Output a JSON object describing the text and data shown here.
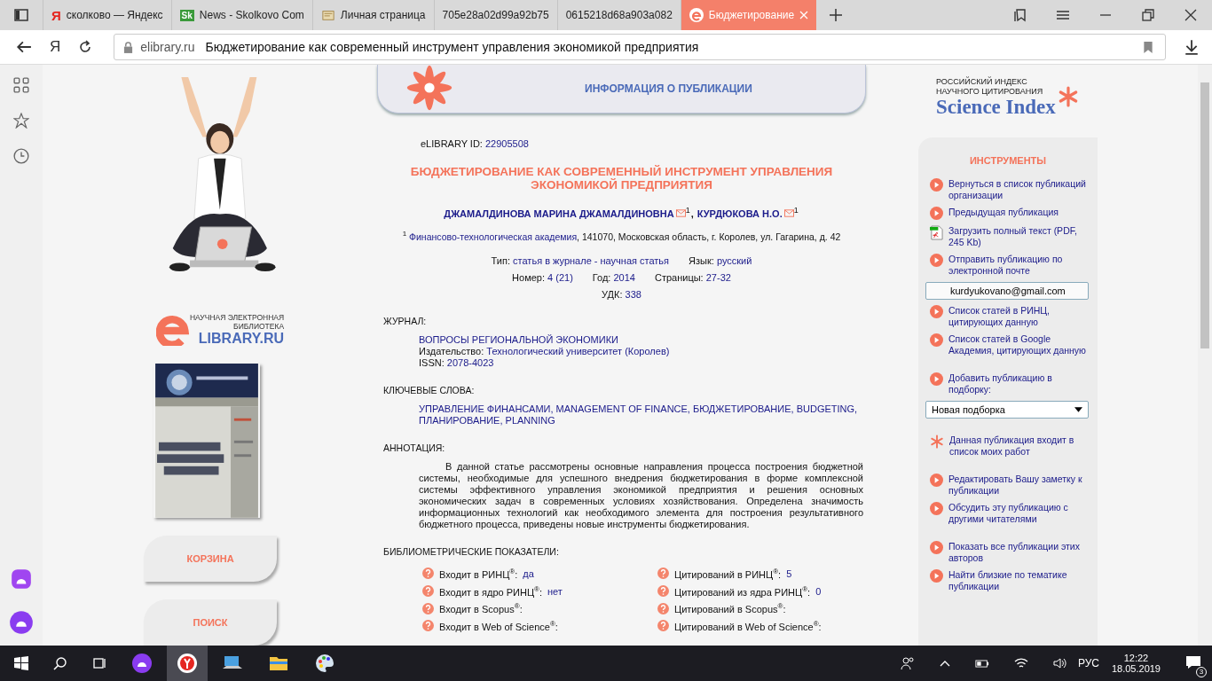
{
  "browser": {
    "tabs": [
      {
        "title": "сколково — Яндекс",
        "kind": "glyph",
        "glyph": "Я",
        "selected": false
      },
      {
        "title": "News - Skolkovo Com",
        "kind": "badge",
        "glyph": "Sk",
        "selected": false
      },
      {
        "title": "Личная страница",
        "kind": "page",
        "selected": false
      },
      {
        "title": "705e28a02d99a92b75",
        "kind": "plain",
        "selected": false
      },
      {
        "title": "0615218d68a903a082",
        "kind": "plain",
        "selected": false
      },
      {
        "title": "Бюджетирование",
        "kind": "site",
        "selected": true
      }
    ],
    "home_button": "Я",
    "address": {
      "domain": "elibrary.ru",
      "title": "Бюджетирование как современный инструмент управления экономикой предприятия"
    }
  },
  "left": {
    "logo": {
      "line1": "НАУЧНАЯ ЭЛЕКТРОННАЯ",
      "line2": "БИБЛИОТЕКА",
      "name": "LIBRARY.RU"
    },
    "buttons": [
      "КОРЗИНА",
      "ПОИСК"
    ]
  },
  "header": "ИНФОРМАЦИЯ О ПУБЛИКАЦИИ",
  "article": {
    "id_label": "eLIBRARY ID:",
    "id": "22905508",
    "title": "БЮДЖЕТИРОВАНИЕ КАК СОВРЕМЕННЫЙ ИНСТРУМЕНТ УПРАВЛЕНИЯ ЭКОНОМИКОЙ ПРЕДПРИЯТИЯ",
    "authors": [
      {
        "name": "ДЖАМАЛДИНОВА МАРИНА ДЖАМАЛДИНОВНА",
        "sup": "1",
        "separator": ","
      },
      {
        "name": "КУРДЮКОВА Н.О.",
        "sup": "1"
      }
    ],
    "affiliation": {
      "sup": "1",
      "name": "Финансово-технологическая академия",
      "address": ", 141070, Московская область, г. Королев, ул. Гагарина, д. 42"
    },
    "meta": [
      [
        {
          "label": "Тип:",
          "value": "статья в журнале - научная статья"
        },
        {
          "label": "Язык:",
          "value": "русский"
        }
      ],
      [
        {
          "label": "Номер:",
          "value": "4 (21)"
        },
        {
          "label": "Год:",
          "value": "2014"
        },
        {
          "label": "Страницы:",
          "value": "27-32"
        }
      ],
      [
        {
          "label": "УДК:",
          "value": "338"
        }
      ]
    ],
    "journal": {
      "heading": "ЖУРНАЛ:",
      "name": "ВОПРОСЫ РЕГИОНАЛЬНОЙ ЭКОНОМИКИ",
      "publisher_label": "Издательство:",
      "publisher": "Технологический университет (Королев)",
      "issn_label": "ISSN:",
      "issn": "2078-4023"
    },
    "keywords": {
      "heading": "КЛЮЧЕВЫЕ СЛОВА:",
      "text": "УПРАВЛЕНИЕ ФИНАНСАМИ, MANAGEMENT OF FINANCE, БЮДЖЕТИРОВАНИЕ, BUDGETING, ПЛАНИРОВАНИЕ, PLANNING"
    },
    "abstract": {
      "heading": "АННОТАЦИЯ:",
      "text": "В данной статье рассмотрены основные направления процесса построения бюджетной системы, необходимые для успешного внедрения бюджетирования в форме комплексной системы эффективного управления экономикой предприятия и решения основных экономических задач в современных условиях хозяйствования. Определена значимость информационных технологий как необходимого элемента для построения результативного бюджетного процесса, приведены новые инструменты бюджетирования."
    },
    "metrics": {
      "heading": "БИБЛИОМЕТРИЧЕСКИЕ ПОКАЗАТЕЛИ:",
      "items": [
        {
          "label": "Входит в РИНЦ$^{®}$:",
          "value": "да"
        },
        {
          "label": "Цитирований в РИНЦ$^{®}$:",
          "value": "5"
        },
        {
          "label": "Входит в ядро РИНЦ$^{®}$:",
          "value": "нет"
        },
        {
          "label": "Цитирований из ядра РИНЦ$^{®}$:",
          "value": "0"
        },
        {
          "label": "Входит в Scopus$^{®}$:"
        },
        {
          "label": "Цитирований в Scopus$^{®}$:"
        },
        {
          "label": "Входит в Web of Science$^{®}$:"
        },
        {
          "label": "Цитирований в Web of Science$^{®}$:"
        }
      ]
    }
  },
  "right": {
    "logo": {
      "line1": "РОССИЙСКИЙ ИНДЕКС",
      "line2": "НАУЧНОГО ЦИТИРОВАНИЯ",
      "name": "Science Index"
    },
    "tools_title": "ИНСТРУМЕНТЫ",
    "groups": [
      [
        {
          "kind": "action",
          "text": "Вернуться в список публикаций организации"
        },
        {
          "kind": "action",
          "text": "Предыдущая публикация"
        },
        {
          "kind": "download",
          "text": "Загрузить полный текст (PDF, 245 Kb)"
        },
        {
          "kind": "action",
          "text": "Отправить публикацию по электронной почте"
        },
        {
          "kind": "input",
          "value": "kurdyukovano@gmail.com"
        },
        {
          "kind": "action",
          "text": "Список статей в РИНЦ, цитирующих данную"
        },
        {
          "kind": "action",
          "text": "Список статей в Google Академия, цитирующих данную"
        }
      ],
      [
        {
          "kind": "action",
          "text": "Добавить публикацию в подборку:"
        },
        {
          "kind": "select",
          "value": "Новая подборка"
        }
      ],
      [
        {
          "kind": "marker",
          "text": "Данная публикация входит в список моих работ"
        }
      ],
      [
        {
          "kind": "action",
          "text": "Редактировать Вашу заметку к публикации"
        },
        {
          "kind": "action",
          "text": "Обсудить эту публикацию с другими читателями"
        }
      ],
      [
        {
          "kind": "action",
          "text": "Показать все публикации этих авторов"
        },
        {
          "kind": "action",
          "text": "Найти близкие по тематике публикации"
        }
      ]
    ]
  },
  "taskbar": {
    "language": "РУС",
    "time": "12:22",
    "date": "18.05.2019",
    "notifications": "3"
  }
}
